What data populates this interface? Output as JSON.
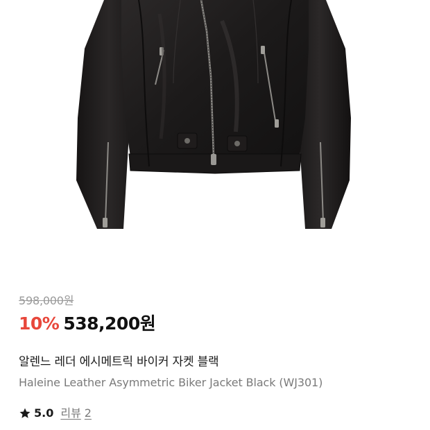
{
  "product": {
    "image_icon": "leather-jacket-photo",
    "original_price": "598,000원",
    "discount_rate": "10%",
    "sale_price": "538,200원",
    "name_ko": "알렌느 레더 에시메트릭 바이커 자켓 블랙",
    "name_en": "Haleine Leather Asymmetric Biker Jacket Black (WJ301)",
    "rating": "5.0",
    "review_label": "리뷰",
    "review_count": "2"
  },
  "colors": {
    "discount": "#e8473b",
    "price": "#111111",
    "muted": "#7a7a7a",
    "strikethrough": "#9a9a9a"
  }
}
